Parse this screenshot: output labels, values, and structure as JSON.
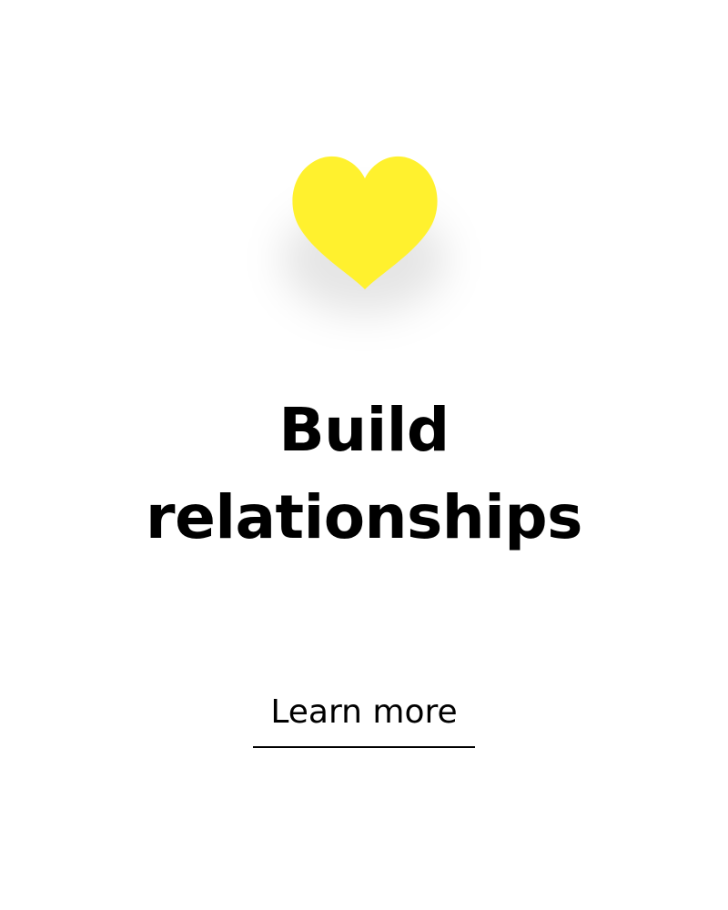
{
  "card": {
    "icon": "heart-icon",
    "icon_color": "#FFF12E",
    "headline_line1": "Build",
    "headline_line2": "relationships",
    "cta_label": "Learn more"
  }
}
